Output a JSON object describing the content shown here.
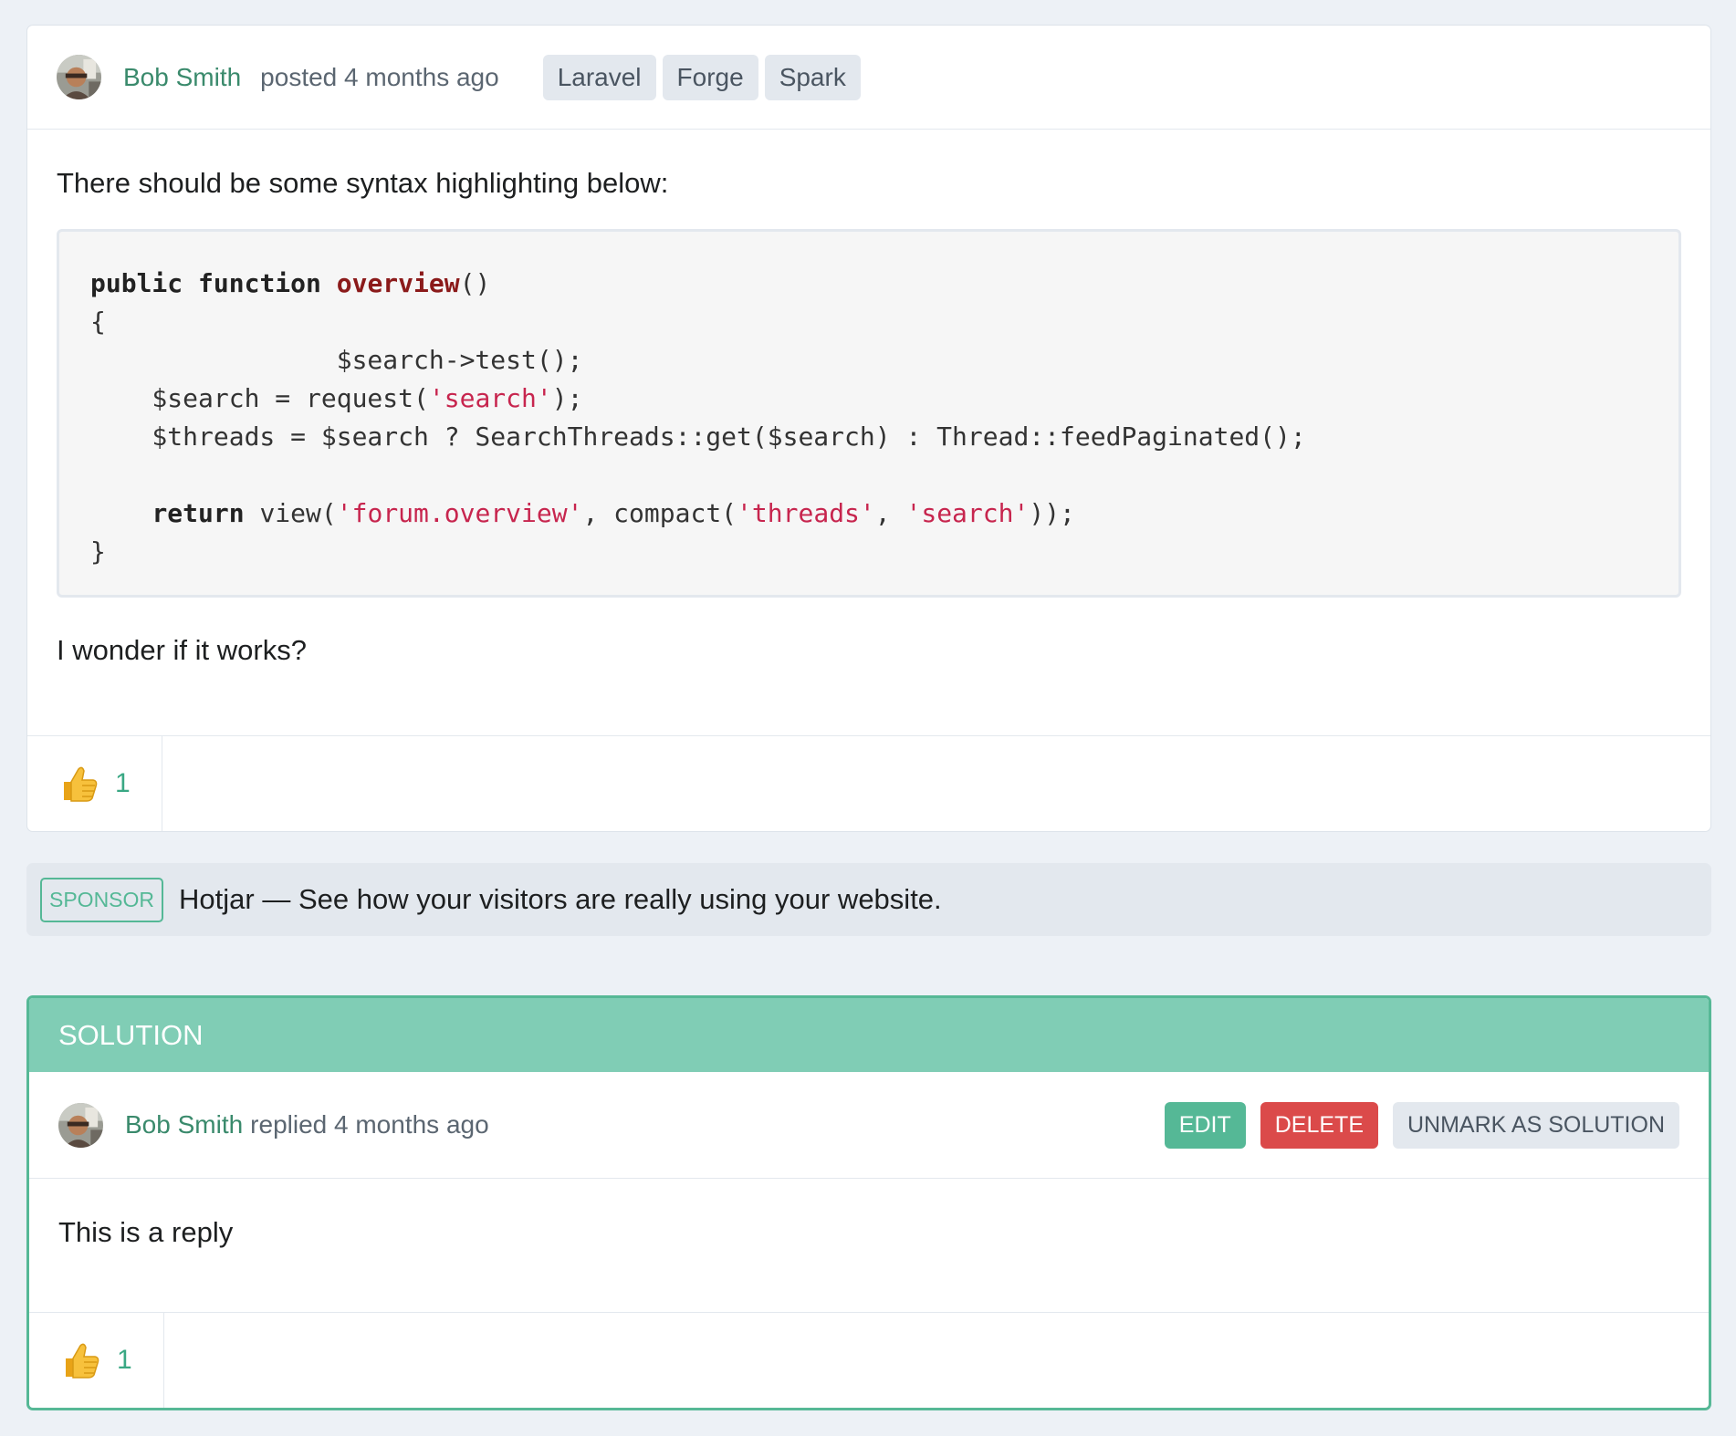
{
  "thread": {
    "author": "Bob Smith",
    "posted_text": "posted 4 months ago",
    "tags": [
      "Laravel",
      "Forge",
      "Spark"
    ],
    "intro": "There should be some syntax highlighting below:",
    "code_lines": [
      [
        {
          "t": "public",
          "c": "kw"
        },
        {
          "t": " "
        },
        {
          "t": "function",
          "c": "kw"
        },
        {
          "t": " "
        },
        {
          "t": "overview",
          "c": "fn"
        },
        {
          "t": "()"
        }
      ],
      [
        {
          "t": "{"
        }
      ],
      [
        {
          "t": "                $search->test();"
        }
      ],
      [
        {
          "t": "    $search = request("
        },
        {
          "t": "'search'",
          "c": "str"
        },
        {
          "t": ");"
        }
      ],
      [
        {
          "t": "    $threads = $search ? SearchThreads::get($search) : Thread::feedPaginated();"
        }
      ],
      [
        {
          "t": ""
        }
      ],
      [
        {
          "t": "    "
        },
        {
          "t": "return",
          "c": "kw"
        },
        {
          "t": " view("
        },
        {
          "t": "'forum.overview'",
          "c": "str"
        },
        {
          "t": ", compact("
        },
        {
          "t": "'threads'",
          "c": "str"
        },
        {
          "t": ", "
        },
        {
          "t": "'search'",
          "c": "str"
        },
        {
          "t": "));"
        }
      ],
      [
        {
          "t": "}"
        }
      ]
    ],
    "outro": "I wonder if it works?",
    "like_icon": "thumbs-up-icon",
    "like_count": "1"
  },
  "sponsor": {
    "badge": "SPONSOR",
    "text": "Hotjar — See how your visitors are really using your website."
  },
  "solution": {
    "banner": "SOLUTION",
    "author": "Bob Smith",
    "replied_text": "replied 4 months ago",
    "edit_label": "EDIT",
    "delete_label": "DELETE",
    "unmark_label": "UNMARK AS SOLUTION",
    "body": "This is a reply",
    "like_icon": "thumbs-up-icon",
    "like_count": "1"
  },
  "colors": {
    "accent": "#55b896",
    "author_link": "#3a8a6c",
    "delete": "#db4a4a",
    "solution_banner": "#80cdb5",
    "page_bg": "#edf1f6"
  }
}
